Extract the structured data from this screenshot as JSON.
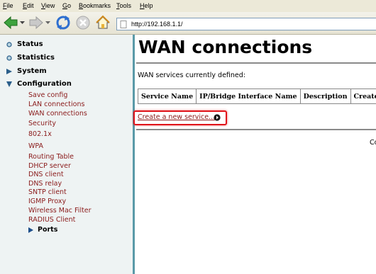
{
  "menubar": {
    "items": [
      "File",
      "Edit",
      "View",
      "Go",
      "Bookmarks",
      "Tools",
      "Help"
    ]
  },
  "toolbar": {
    "icons": [
      "back-arrow-icon",
      "forward-arrow-icon",
      "reload-icon",
      "stop-icon",
      "home-icon"
    ],
    "url": "http://192.168.1.1/"
  },
  "sidebar": {
    "top_items": [
      {
        "label": "Status",
        "icon": "bullet-icon"
      },
      {
        "label": "Statistics",
        "icon": "bullet-icon"
      },
      {
        "label": "System",
        "icon": "collapsed-arrow-icon"
      },
      {
        "label": "Configuration",
        "icon": "expanded-arrow-icon"
      }
    ],
    "config_items": [
      "Save config",
      "LAN connections",
      "WAN connections",
      "Security",
      "802.1x",
      "WPA",
      "Routing Table",
      "DHCP server",
      "DNS client",
      "DNS relay",
      "SNTP client",
      "IGMP Proxy",
      "Wireless Mac Filter",
      "RADIUS Client"
    ],
    "ports_label": "Ports"
  },
  "main": {
    "title": "WAN connections",
    "subtitle": "WAN services currently defined:",
    "table_headers": [
      "Service Name",
      "IP/Bridge Interface Name",
      "Description",
      "Creator"
    ],
    "create_link": "Create a new service...",
    "footer_fragment": "Co"
  },
  "colors": {
    "sidebar_bg": "#eef3f3",
    "divider": "#5a9aa8",
    "link": "#8a1a1a",
    "highlight": "#e0141a"
  }
}
